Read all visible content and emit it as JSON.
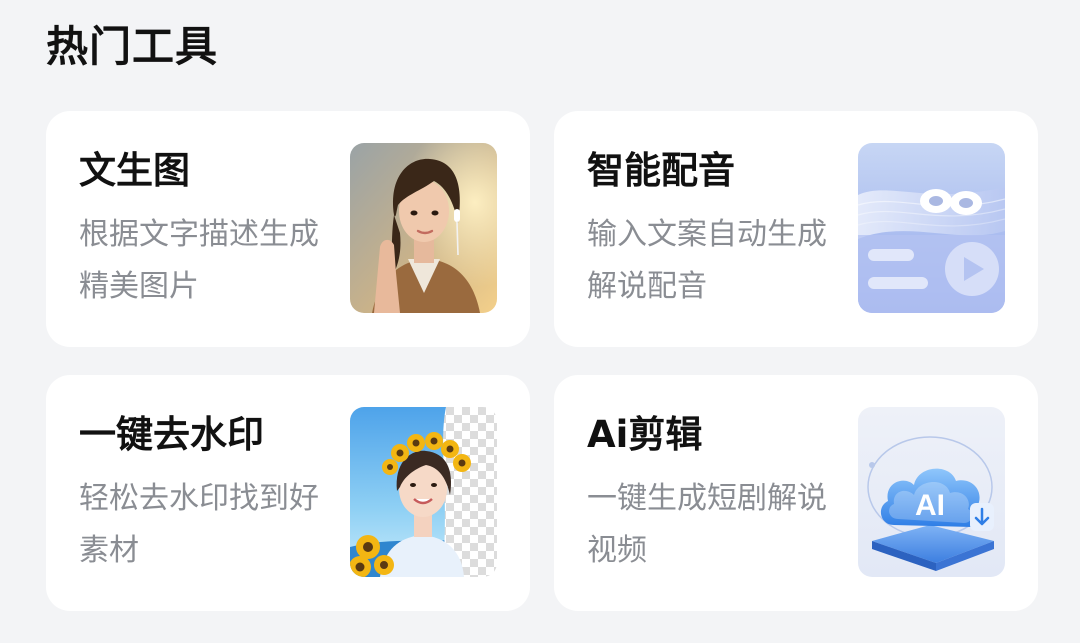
{
  "section": {
    "title": "热门工具"
  },
  "tools": [
    {
      "title": "文生图",
      "description": "根据文字描述生成精美图片",
      "thumbnail_icon": "portrait-photo-icon"
    },
    {
      "title": "智能配音",
      "description": "输入文案自动生成解说配音",
      "thumbnail_icon": "earbuds-audio-icon"
    },
    {
      "title": "一键去水印",
      "description": "轻松去水印找到好素材",
      "thumbnail_icon": "watermark-removal-icon"
    },
    {
      "title": "Ai剪辑",
      "description": "一键生成短剧解说视频",
      "thumbnail_icon": "ai-cloud-icon"
    }
  ],
  "colors": {
    "page_background": "#f3f4f6",
    "card_background": "#ffffff",
    "title_text": "#111111",
    "description_text": "#8a8d93",
    "accent_blue": "#4a8ff2"
  }
}
